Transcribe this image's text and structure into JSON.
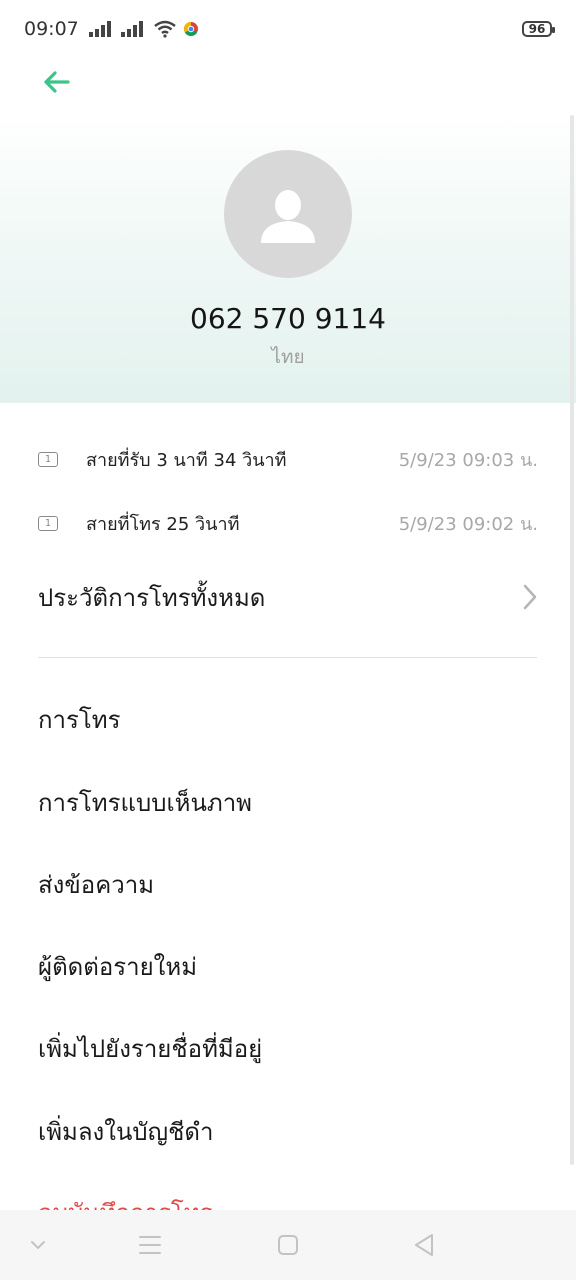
{
  "status_bar": {
    "time": "09:07",
    "battery": "96"
  },
  "contact": {
    "phone": "062 570 9114",
    "location": "ไทย"
  },
  "calls": [
    {
      "sim": "1",
      "description": "สายที่รับ  3  นาที 34 วินาที",
      "time": "5/9/23 09:03 น."
    },
    {
      "sim": "1",
      "description": "สายที่โทร  25 วินาที",
      "time": "5/9/23 09:02 น."
    }
  ],
  "history_label": "ประวัติการโทรทั้งหมด",
  "actions": [
    "การโทร",
    "การโทรแบบเห็นภาพ",
    "ส่งข้อความ",
    "ผู้ติดต่อรายใหม่",
    "เพิ่มไปยังรายชื่อที่มีอยู่",
    "เพิ่มลงในบัญชีดำ",
    "ลบบันทึกการโทร"
  ],
  "colors": {
    "accent": "#3cc48a",
    "danger": "#e24a4a"
  }
}
